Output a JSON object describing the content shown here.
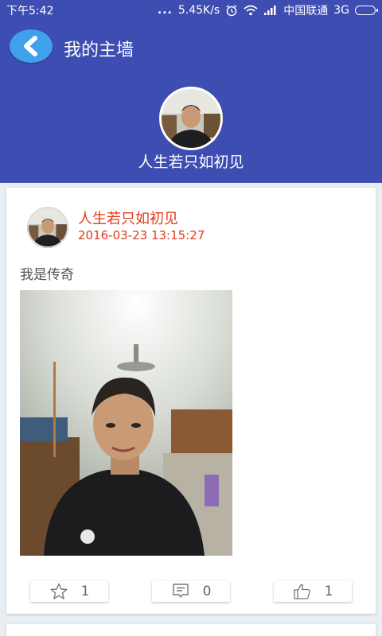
{
  "status_bar": {
    "time": "下午5:42",
    "dots": "...",
    "speed": "5.45K/s",
    "carrier": "中国联通",
    "network": "3G"
  },
  "header": {
    "title": "我的主墙",
    "profile_name": "人生若只如初见",
    "back_icon": "back-arrow-icon"
  },
  "post": {
    "username": "人生若只如初见",
    "timestamp": "2016-03-23 13:15:27",
    "text": "我是传奇",
    "actions": {
      "favorite_count": "1",
      "comment_count": "0",
      "like_count": "1"
    }
  },
  "colors": {
    "primary": "#3d4db1",
    "accent": "#3fa1ec",
    "username": "#e23b1b"
  }
}
